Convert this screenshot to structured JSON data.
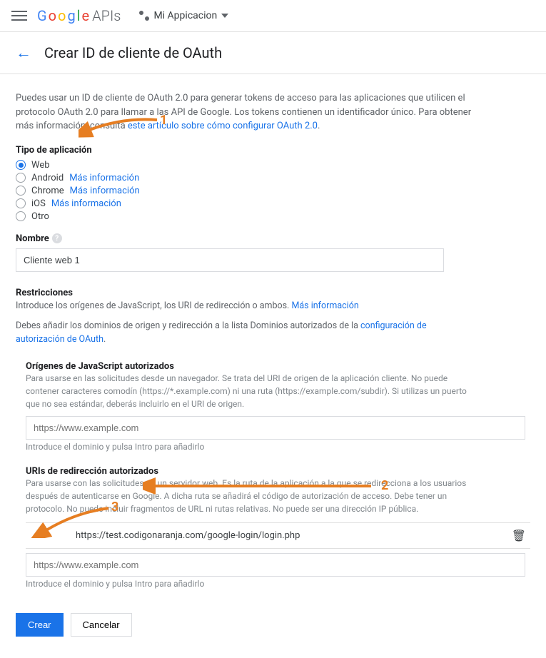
{
  "topbar": {
    "logo_apis": "APIs",
    "project_name": "Mi Appicacion"
  },
  "header": {
    "title": "Crear ID de cliente de OAuth"
  },
  "intro": {
    "text1": "Puedes usar un ID de cliente de OAuth 2.0 para generar tokens de acceso para las aplicaciones que utilicen el protocolo OAuth 2.0 para llamar a las API de Google. Los tokens contienen un identificador único. Para obtener más información, consulta ",
    "link": "este artículo sobre cómo configurar OAuth 2.0",
    "period": "."
  },
  "app_type": {
    "label": "Tipo de aplicación",
    "options": [
      {
        "label": "Web",
        "selected": true,
        "more": ""
      },
      {
        "label": "Android",
        "selected": false,
        "more": "Más información"
      },
      {
        "label": "Chrome",
        "selected": false,
        "more": "Más información"
      },
      {
        "label": "iOS",
        "selected": false,
        "more": "Más información"
      },
      {
        "label": "Otro",
        "selected": false,
        "more": ""
      }
    ]
  },
  "name": {
    "label": "Nombre",
    "value": "Cliente web 1"
  },
  "restrictions": {
    "title": "Restricciones",
    "desc1": "Introduce los orígenes de JavaScript, los URI de redirección o ambos. ",
    "desc1_link": "Más información",
    "desc2a": "Debes añadir los dominios de origen y redirección a la lista Dominios autorizados de la ",
    "desc2_link": "configuración de autorización de OAuth",
    "desc2b": "."
  },
  "js_origins": {
    "label": "Orígenes de JavaScript autorizados",
    "desc": "Para usarse en las solicitudes desde un navegador. Se trata del URI de origen de la aplicación cliente. No puede contener caracteres comodín (https://*.example.com) ni una ruta (https://example.com/subdir). Si utilizas un puerto que no sea estándar, deberás incluirlo en el URI de origen.",
    "placeholder": "https://www.example.com",
    "hint": "Introduce el dominio y pulsa Intro para añadirlo"
  },
  "redirect_uris": {
    "label": "URIs de redirección autorizados",
    "desc": "Para usarse con las solicitudes de un servidor web. Es la ruta de la aplicación a la que se redirecciona a los usuarios después de autenticarse en Google. A dicha ruta se añadirá el código de autorización de acceso. Debe tener un protocolo. No puede incluir fragmentos de URL ni rutas relativas. No puede ser una dirección IP pública.",
    "existing": "https://test.codigonaranja.com/google-login/login.php",
    "placeholder": "https://www.example.com",
    "hint": "Introduce el dominio y pulsa Intro para añadirlo"
  },
  "buttons": {
    "create": "Crear",
    "cancel": "Cancelar"
  },
  "annotations": {
    "n1": "1",
    "n2": "2",
    "n3": "3"
  }
}
